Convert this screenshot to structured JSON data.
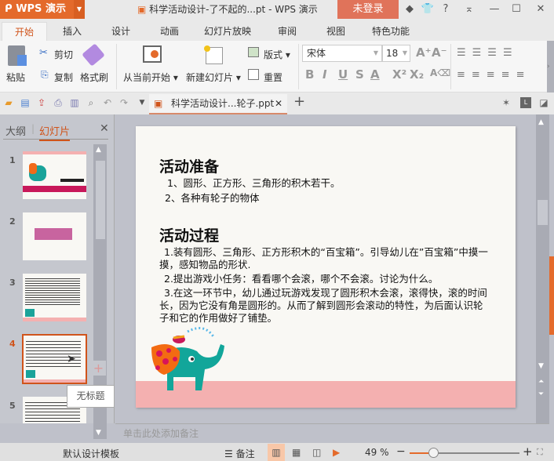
{
  "titlebar": {
    "app": "WPS 演示",
    "title": "科学活动设计-了不起的...pt - WPS 演示",
    "login": "未登录"
  },
  "tabs": [
    "开始",
    "插入",
    "设计",
    "动画",
    "幻灯片放映",
    "审阅",
    "视图",
    "特色功能"
  ],
  "ribbon": {
    "paste": "粘贴",
    "cut": "剪切",
    "copy": "复制",
    "format_painter": "格式刷",
    "from_current": "从当前开始",
    "new_slide": "新建幻灯片",
    "layout": "版式",
    "reset": "重置",
    "font": "宋体",
    "size": "18"
  },
  "file_tab": {
    "name": "科学活动设计...轮子.ppt"
  },
  "left_panel": {
    "tabs": [
      "大纲",
      "幻灯片"
    ],
    "slides": [
      "1",
      "2",
      "3",
      "4",
      "5"
    ],
    "selected": 4,
    "tooltip": "无标题"
  },
  "slide": {
    "heading1": "活动准备",
    "prep": [
      "1、圆形、正方形、三角形的积木若干。",
      "2、各种有轮子的物体"
    ],
    "heading2": "活动过程",
    "process": [
      "1.装有圆形、三角形、正方形积木的“百宝箱”。引导幼儿在”百宝箱”中摸一摸，感知物品的形状.",
      "2.提出游戏小任务：看看哪个会滚，哪个不会滚。讨论为什么。",
      "3.在这一环节中，幼儿通过玩游戏发现了圆形积木会滚，滚得快，滚的时间长，因为它没有角是圆形的。从而了解到圆形会滚动的特性，为后面认识轮子和它的作用做好了铺垫。"
    ]
  },
  "notes_placeholder": "单击此处添加备注",
  "status": {
    "template": "默认设计模板",
    "notes": "备注",
    "zoom": "49 %",
    "zoom_value": 49
  },
  "colors": {
    "accent": "#e46a2b",
    "login": "#e0735a",
    "slide_band": "#f4b0b0"
  }
}
